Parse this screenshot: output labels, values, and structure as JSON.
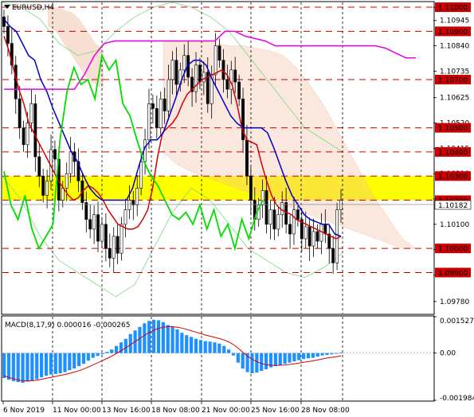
{
  "chart_data": [
    {
      "type": "candlestick",
      "symbol_header": "EURUSD,H4",
      "price_range": [
        1.0973,
        1.1102
      ],
      "price_ticks": [
        "1.11000",
        "1.10945",
        "1.10840",
        "1.10735",
        "1.10625",
        "1.10520",
        "1.10415",
        "1.10310",
        "1.10205",
        "1.10100",
        "1.09995",
        "1.09890",
        "1.09780"
      ],
      "horizontal_levels": [
        {
          "label": "1.11000",
          "value": 1.11
        },
        {
          "label": "1.10900",
          "value": 1.109
        },
        {
          "label": "1.10700",
          "value": 1.107
        },
        {
          "label": "1.10500",
          "value": 1.105
        },
        {
          "label": "1.10400",
          "value": 1.104
        },
        {
          "label": "1.10300",
          "value": 1.103
        },
        {
          "label": "1.10200",
          "value": 1.102
        },
        {
          "label": "1.10000",
          "value": 1.1
        },
        {
          "label": "1.09900",
          "value": 1.099
        }
      ],
      "current_price_label": "1.10182",
      "current_price": 1.10182,
      "highlight_zone": {
        "from": 1.102,
        "to": 1.103,
        "color": "#ffff00"
      },
      "x_labels": [
        "6 Nov 2019",
        "11 Nov 00:00",
        "13 Nov 16:00",
        "18 Nov 08:00",
        "21 Nov 00:00",
        "25 Nov 16:00",
        "28 Nov 08:00"
      ],
      "close_path": [
        1.1092,
        1.1085,
        1.1076,
        1.1062,
        1.105,
        1.1043,
        1.1052,
        1.106,
        1.1038,
        1.103,
        1.1022,
        1.1028,
        1.1041,
        1.1037,
        1.102,
        1.1025,
        1.1031,
        1.104,
        1.1036,
        1.1028,
        1.1019,
        1.1012,
        1.1008,
        1.1014,
        1.1003,
        1.101,
        1.1,
        1.0996,
        1.1005,
        1.0998,
        1.101,
        1.1016,
        1.102,
        1.1018,
        1.1025,
        1.1036,
        1.1045,
        1.106,
        1.1058,
        1.105,
        1.1062,
        1.1057,
        1.107,
        1.1078,
        1.1068,
        1.1074,
        1.108,
        1.1071,
        1.1065,
        1.1076,
        1.1069,
        1.1073,
        1.106,
        1.1072,
        1.1084,
        1.1078,
        1.107,
        1.1066,
        1.1074,
        1.1069,
        1.1062,
        1.1045,
        1.103,
        1.102,
        1.1012,
        1.1018,
        1.1024,
        1.101,
        1.1016,
        1.1008,
        1.1014,
        1.1019,
        1.101,
        1.1006,
        1.1016,
        1.1012,
        1.1004,
        1.1009,
        1.1001,
        1.1007,
        1.1003,
        1.101,
        1.1006,
        1.1,
        1.0994,
        1.1016,
        1.102
      ],
      "indicator_lines": [
        {
          "name": "red",
          "color": "#d40000",
          "values": [
            1.1088,
            1.1082,
            1.1074,
            1.1066,
            1.106,
            1.1052,
            1.1048,
            1.1044,
            1.104,
            1.1036,
            1.1032,
            1.1028,
            1.1025,
            1.1022,
            1.102,
            1.1021,
            1.1024,
            1.1026,
            1.1025,
            1.1023,
            1.102,
            1.1016,
            1.1013,
            1.101,
            1.1009,
            1.1008,
            1.1008,
            1.1009,
            1.1012,
            1.1016,
            1.1025,
            1.1038,
            1.1048,
            1.105,
            1.1052,
            1.1055,
            1.106,
            1.1064,
            1.1066,
            1.1068,
            1.107,
            1.1071,
            1.1072,
            1.1073,
            1.1074,
            1.1072,
            1.1068,
            1.106,
            1.105,
            1.1045,
            1.1044,
            1.1043,
            1.1035,
            1.1028,
            1.1022,
            1.1018,
            1.1016,
            1.1015,
            1.1014,
            1.1012,
            1.1011,
            1.101,
            1.1009,
            1.1008,
            1.1007,
            1.1006,
            1.1005,
            1.1004,
            1.1005
          ]
        },
        {
          "name": "blue",
          "color": "#0000c8",
          "values": [
            1.1095,
            1.1092,
            1.109,
            1.1085,
            1.108,
            1.1078,
            1.107,
            1.1065,
            1.1058,
            1.1052,
            1.1046,
            1.104,
            1.1036,
            1.103,
            1.1025,
            1.1022,
            1.102,
            1.102,
            1.102,
            1.102,
            1.102,
            1.1025,
            1.1034,
            1.1042,
            1.1045,
            1.1045,
            1.1048,
            1.1055,
            1.1062,
            1.107,
            1.1076,
            1.1078,
            1.1078,
            1.1076,
            1.107,
            1.1065,
            1.106,
            1.1055,
            1.1052,
            1.105,
            1.105,
            1.105,
            1.105,
            1.1048,
            1.1042,
            1.1035,
            1.1028,
            1.1022,
            1.1018,
            1.1014,
            1.1012,
            1.1011,
            1.101,
            1.101,
            1.1006,
            1.1005
          ]
        },
        {
          "name": "magenta",
          "color": "#e600e6",
          "values": [
            1.1066,
            1.1066,
            1.1066,
            1.1066,
            1.1066,
            1.1066,
            1.1066,
            1.1066,
            1.1072,
            1.108,
            1.1085,
            1.1086,
            1.1086,
            1.1086,
            1.1086,
            1.1086,
            1.1086,
            1.1086,
            1.1086,
            1.1086,
            1.1086,
            1.1086,
            1.109,
            1.109,
            1.1088,
            1.1087,
            1.1086,
            1.1084,
            1.1084,
            1.1084,
            1.1084,
            1.1084,
            1.1084,
            1.1084,
            1.1084,
            1.1084,
            1.1084,
            1.1084,
            1.1083,
            1.1081,
            1.1079,
            1.1079
          ]
        },
        {
          "name": "green",
          "color": "#00dd00",
          "values": [
            1.1032,
            1.1018,
            1.1012,
            1.1022,
            1.1008,
            1.1,
            1.1005,
            1.101,
            1.1045,
            1.1065,
            1.1075,
            1.1068,
            1.107,
            1.1062,
            1.108,
            1.1074,
            1.1078,
            1.106,
            1.1055,
            1.1045,
            1.1036,
            1.103,
            1.1026,
            1.102,
            1.1014,
            1.1012,
            1.1015,
            1.101,
            1.1018,
            1.1008,
            1.1016,
            1.1005,
            1.101,
            1.1,
            1.1012,
            1.1004,
            1.1014,
            1.102
          ]
        }
      ],
      "cloud_color": "#f0b9a0"
    },
    {
      "type": "histogram",
      "title": "MACD(8,17,9) 0.000016 -0.000265",
      "y_ticks": [
        "0.001527",
        "0.00",
        "-0.001984"
      ],
      "ylim": [
        -0.001984,
        0.001527
      ],
      "bar_color": "#1e90ff",
      "signal_color": "#d40000",
      "values": [
        -0.00105,
        -0.00112,
        -0.00118,
        -0.00122,
        -0.00125,
        -0.0012,
        -0.00115,
        -0.0011,
        -0.00102,
        -0.00095,
        -0.0009,
        -0.00088,
        -0.00085,
        -0.0008,
        -0.00072,
        -0.00065,
        -0.00055,
        -0.00045,
        -0.00032,
        -0.0002,
        -0.00012,
        -5e-05,
        5e-05,
        0.00015,
        0.0003,
        0.00045,
        0.0006,
        0.0008,
        0.00095,
        0.0011,
        0.00125,
        0.00135,
        0.0014,
        0.00138,
        0.0013,
        0.00118,
        0.0011,
        0.001,
        0.00085,
        0.00075,
        0.00068,
        0.0006,
        0.00055,
        0.0005,
        0.00048,
        0.00045,
        0.0004,
        0.0003,
        0.00015,
        -0.0001,
        -0.0004,
        -0.00065,
        -0.0008,
        -0.00085,
        -0.00082,
        -0.00075,
        -0.00068,
        -0.0006,
        -0.00055,
        -0.0005,
        -0.00045,
        -0.0004,
        -0.00035,
        -0.0003,
        -0.00025,
        -0.00022,
        -0.0002,
        -0.00015,
        -0.0001,
        -8e-05,
        -5e-05,
        -3e-05,
        2e-05
      ],
      "signal": [
        -0.00095,
        -0.00102,
        -0.00108,
        -0.00113,
        -0.00116,
        -0.00117,
        -0.00116,
        -0.00114,
        -0.0011,
        -0.00106,
        -0.00102,
        -0.00098,
        -0.00094,
        -0.0009,
        -0.00085,
        -0.0008,
        -0.00074,
        -0.00067,
        -0.00059,
        -0.0005,
        -0.00041,
        -0.00032,
        -0.00023,
        -0.00013,
        -2e-05,
        0.0001,
        0.00022,
        0.00035,
        0.00048,
        0.00061,
        0.00074,
        0.00086,
        0.00096,
        0.00104,
        0.00109,
        0.00111,
        0.00111,
        0.00109,
        0.00105,
        0.001,
        0.00094,
        0.00088,
        0.00082,
        0.00076,
        0.00071,
        0.00066,
        0.00061,
        0.00055,
        0.00047,
        0.00036,
        0.00021,
        4e-05,
        -0.00012,
        -0.00026,
        -0.00036,
        -0.00044,
        -0.00049,
        -0.00051,
        -0.00052,
        -0.00051,
        -0.0005,
        -0.00048,
        -0.00045,
        -0.00042,
        -0.00039,
        -0.00036,
        -0.00033,
        -0.00029,
        -0.00025,
        -0.00021,
        -0.00018,
        -0.00015,
        -0.00012
      ]
    }
  ]
}
